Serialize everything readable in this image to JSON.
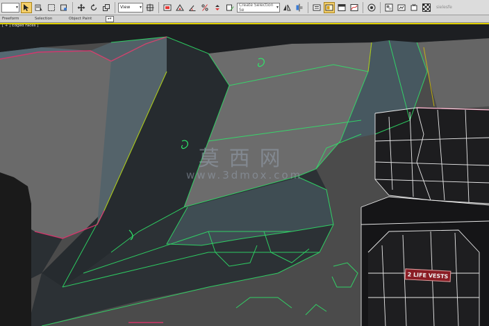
{
  "toolbar": {
    "filter_selector": {
      "value": ""
    },
    "view_selector": {
      "value": "View"
    },
    "named_selection": {
      "value": "Create Selection Se"
    },
    "scene_text": "sielesfe",
    "icons": [
      "select-object",
      "select-by-name",
      "rectangular-selection",
      "window-crossing",
      "select-and-move",
      "select-and-rotate",
      "select-and-scale",
      "use-pivot-center",
      "select-and-manipulate",
      "keyboard-shortcut",
      "snaps-toggle",
      "angle-snap",
      "percent-snap",
      "spinner-snap",
      "edit-named-selection",
      "mirror",
      "align",
      "toggle-scene-explorer",
      "toggle-layer-explorer",
      "toggle-ribbon",
      "curve-editor",
      "schematic-view",
      "material-editor",
      "render-setup",
      "rendered-frame-window",
      "render-production",
      "render-iterative",
      "render-in-cloud",
      "a360-gallery"
    ]
  },
  "ribbon": {
    "items": [
      "Freeform",
      "Selection",
      "Object Paint"
    ]
  },
  "viewport": {
    "label": "[ + ] Edged Faces ]",
    "watermark_cn": "莫西网",
    "watermark_url": "www.3dmox.com",
    "decal_text": "2 LIFE VESTS"
  },
  "colors": {
    "toolbar_bg": "#dcdcdc",
    "viewport_bg": "#4b4b4b",
    "selected_wire": "#2ee86a",
    "unselected_wire": "#ffffff",
    "edge_highlight": "#e0336e",
    "active_viewport_border": "#e0d000"
  }
}
